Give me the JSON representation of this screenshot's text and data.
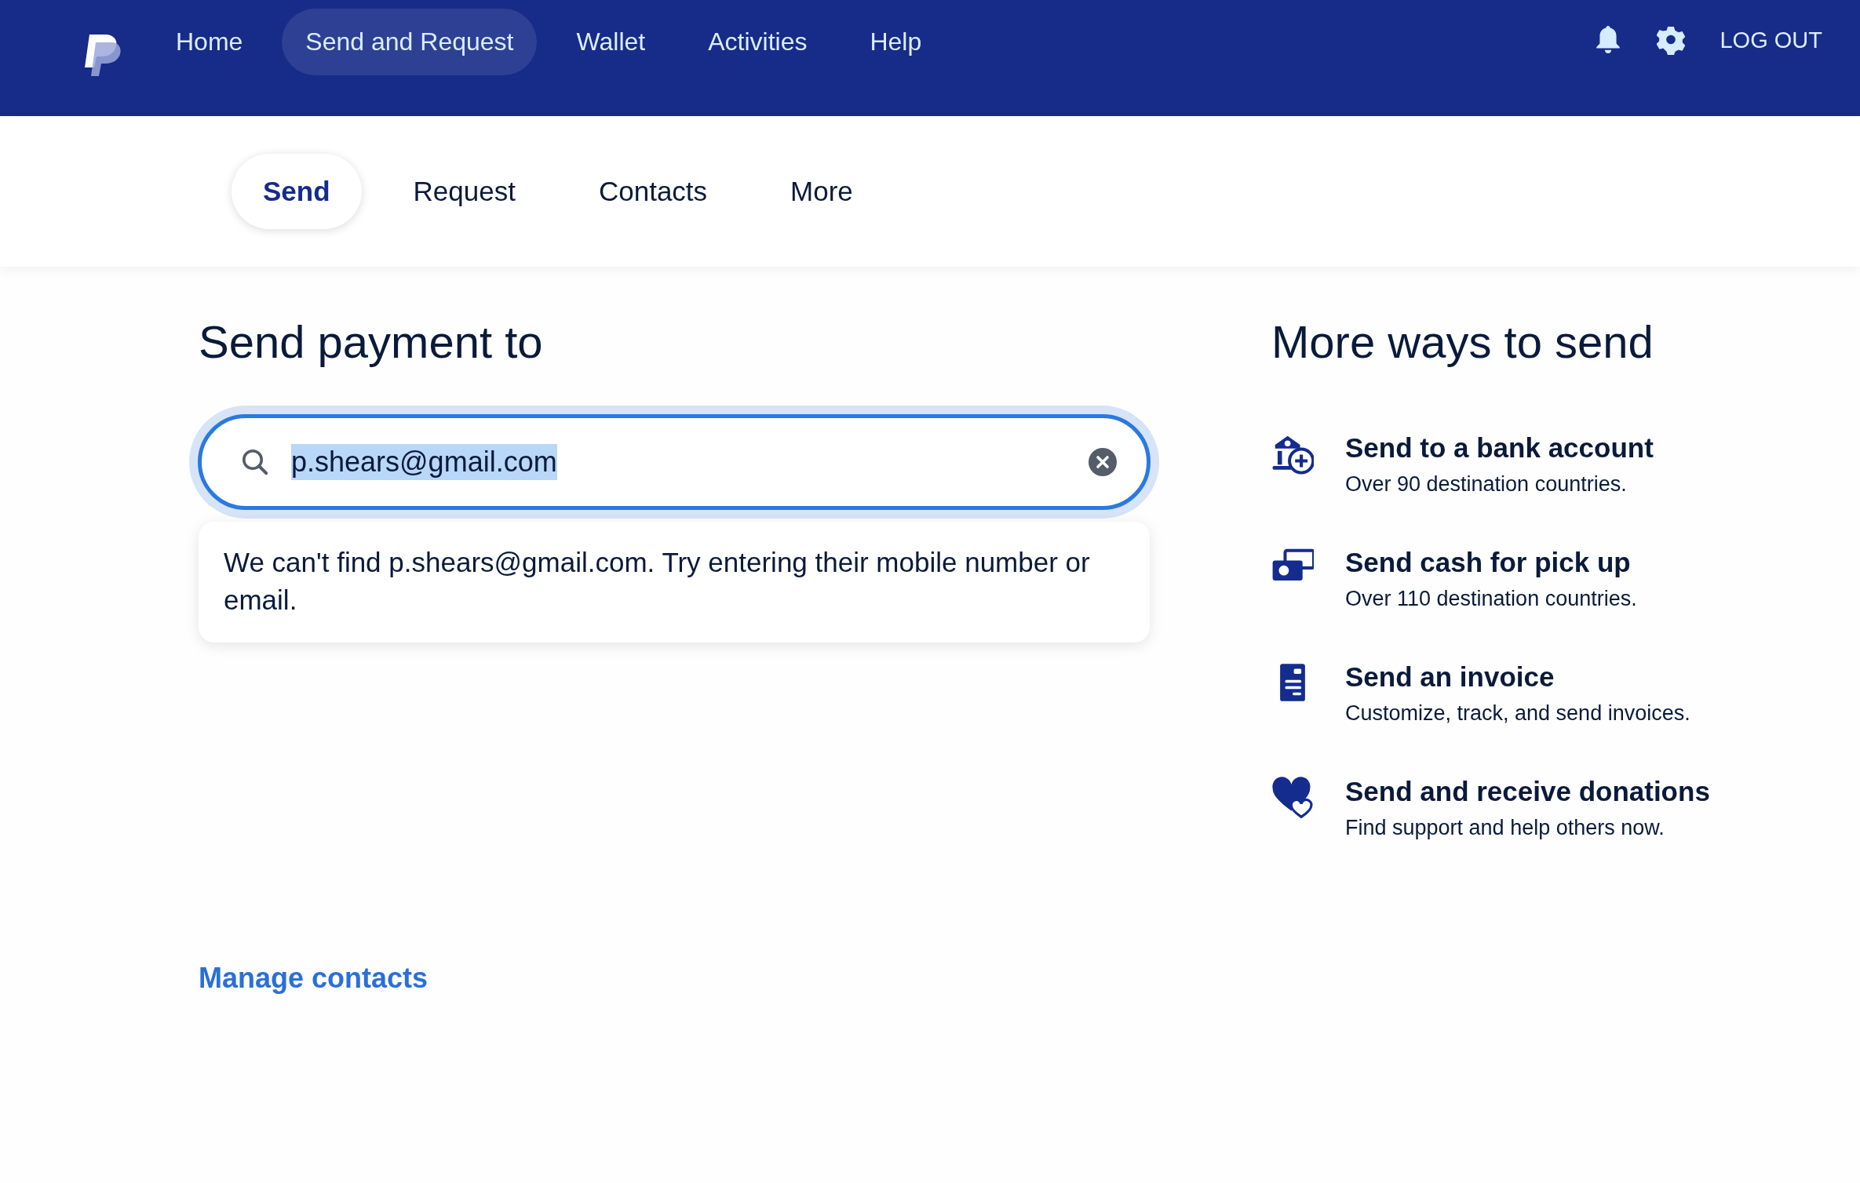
{
  "nav": {
    "items": [
      {
        "label": "Home",
        "selected": false
      },
      {
        "label": "Send and Request",
        "selected": true
      },
      {
        "label": "Wallet",
        "selected": false
      },
      {
        "label": "Activities",
        "selected": false
      },
      {
        "label": "Help",
        "selected": false
      }
    ],
    "logout": "LOG OUT"
  },
  "subnav": {
    "tabs": [
      {
        "label": "Send",
        "selected": true
      },
      {
        "label": "Request",
        "selected": false
      },
      {
        "label": "Contacts",
        "selected": false
      },
      {
        "label": "More",
        "selected": false
      }
    ]
  },
  "send": {
    "heading": "Send payment to",
    "search": {
      "value": "p.shears@gmail.com",
      "text_selected": true
    },
    "error": "We can't find p.shears@gmail.com. Try entering their mobile number or email.",
    "manage_link": "Manage contacts"
  },
  "more_ways": {
    "heading": "More ways to send",
    "items": [
      {
        "kind": "bank",
        "title": "Send to a bank account",
        "description": "Over 90 destination countries."
      },
      {
        "kind": "cash",
        "title": "Send cash for pick up",
        "description": "Over 110 destination countries."
      },
      {
        "kind": "invoice",
        "title": "Send an invoice",
        "description": "Customize, track, and send invoices."
      },
      {
        "kind": "donation",
        "title": "Send and receive donations",
        "description": "Find support and help others now."
      }
    ]
  }
}
